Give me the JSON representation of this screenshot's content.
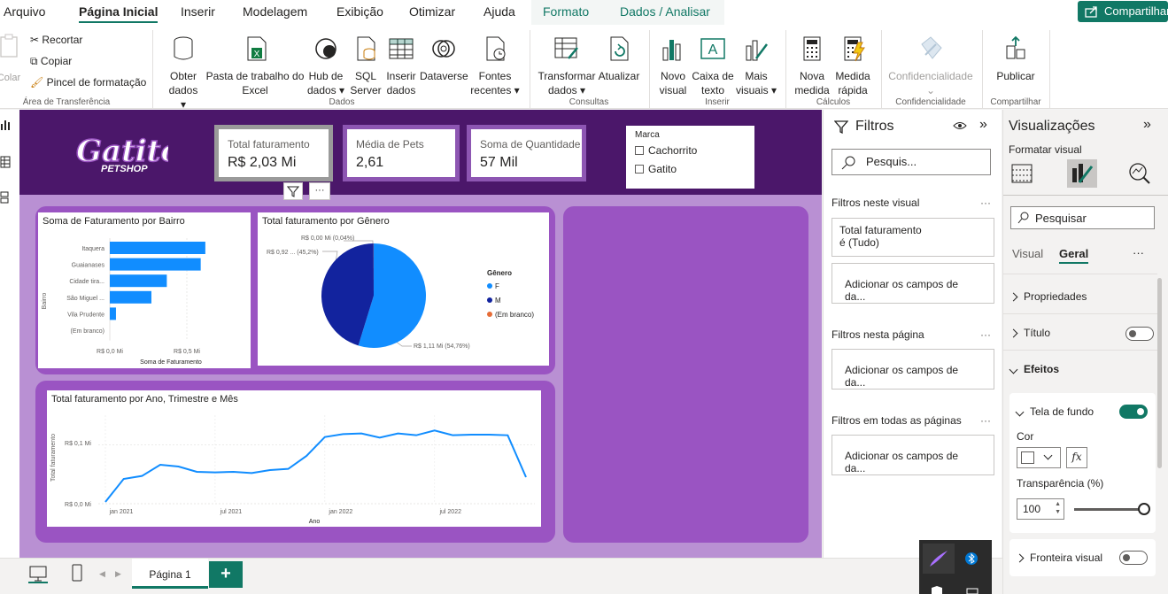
{
  "menubar": {
    "items": [
      "Arquivo",
      "Página Inicial",
      "Inserir",
      "Modelagem",
      "Exibição",
      "Otimizar",
      "Ajuda",
      "Formato",
      "Dados / Analisar"
    ],
    "active": "Página Inicial",
    "share_label": "Compartilhar"
  },
  "ribbon": {
    "clipboard": {
      "paste_label": "Colar",
      "cut": "Recortar",
      "copy": "Copiar",
      "format_painter": "Pincel de formatação",
      "group": "Área de Transferência"
    },
    "data": {
      "buttons": [
        {
          "line1": "Obter",
          "line2": "dados ▾"
        },
        {
          "line1": "Pasta de trabalho do",
          "line2": "Excel"
        },
        {
          "line1": "Hub de",
          "line2": "dados ▾"
        },
        {
          "line1": "SQL",
          "line2": "Server"
        },
        {
          "line1": "Inserir",
          "line2": "dados"
        },
        {
          "line1": "Dataverse",
          "line2": ""
        },
        {
          "line1": "Fontes",
          "line2": "recentes ▾"
        }
      ],
      "group": "Dados"
    },
    "queries": {
      "transform_1": "Transformar",
      "transform_2": "dados ▾",
      "refresh": "Atualizar",
      "group": "Consultas"
    },
    "insert": {
      "new_visual_1": "Novo",
      "new_visual_2": "visual",
      "textbox_1": "Caixa de",
      "textbox_2": "texto",
      "more_1": "Mais",
      "more_2": "visuais ▾",
      "group": "Inserir"
    },
    "calc": {
      "new_measure_1": "Nova",
      "new_measure_2": "medida",
      "quick_measure_1": "Medida",
      "quick_measure_2": "rápida",
      "group": "Cálculos"
    },
    "sensitivity": {
      "label": "Confidencialidade",
      "group": "Confidencialidade"
    },
    "share": {
      "publish": "Publicar",
      "group": "Compartilhar"
    }
  },
  "report": {
    "logo_main": "Gatito",
    "logo_sub": "PETSHOP",
    "cards": [
      {
        "label": "Total faturamento",
        "value": "R$ 2,03 Mi"
      },
      {
        "label": "Média de Pets",
        "value": "2,61"
      },
      {
        "label": "Soma de Quantidade",
        "value": "57 Mil"
      }
    ],
    "slicer": {
      "title": "Marca",
      "options": [
        "Cachorrito",
        "Gatito"
      ]
    },
    "bairro_chart": {
      "title": "Soma de Faturamento por Bairro",
      "ylabel": "Bairro",
      "xlabel": "Soma de Faturamento",
      "xticks": [
        "R$ 0,0 Mi",
        "R$ 0,5 Mi"
      ]
    },
    "genero_chart": {
      "title": "Total faturamento por Gênero",
      "legend_title": "Gênero",
      "labels": [
        "R$ 0,00 Mi (0,04%)",
        "R$ 0,92 ... (45,2%)",
        "R$ 1,11 Mi (54,76%)"
      ]
    },
    "time_chart": {
      "title": "Total faturamento por Ano, Trimestre e Mês",
      "ylabel": "Total faturamento",
      "xlabel": "Ano",
      "yticks": [
        "R$ 0,1 Mi",
        "R$ 0,0 Mi"
      ],
      "xticks": [
        "jan 2021",
        "jul 2021",
        "jan 2022",
        "jul 2022"
      ]
    }
  },
  "chart_data": [
    {
      "type": "bar",
      "title": "Soma de Faturamento por Bairro",
      "categories": [
        "Itaquera",
        "Guaianases",
        "Cidade tira...",
        "São Miguel ...",
        "Vila Prudente",
        "(Em branco)"
      ],
      "values": [
        0.62,
        0.59,
        0.37,
        0.27,
        0.04,
        0.0
      ],
      "xlabel": "Soma de Faturamento",
      "ylabel": "Bairro",
      "xlim": [
        0,
        0.7
      ],
      "color": "#118dff"
    },
    {
      "type": "pie",
      "title": "Total faturamento por Gênero",
      "categories": [
        "F",
        "M",
        "(Em branco)"
      ],
      "values": [
        54.76,
        45.2,
        0.04
      ],
      "colors": [
        "#118dff",
        "#12239e",
        "#e66c37"
      ],
      "legend_title": "Gênero"
    },
    {
      "type": "line",
      "title": "Total faturamento por Ano, Trimestre e Mês",
      "x": [
        "jan 2021",
        "fev 2021",
        "mar 2021",
        "abr 2021",
        "mai 2021",
        "jun 2021",
        "jul 2021",
        "ago 2021",
        "set 2021",
        "out 2021",
        "nov 2021",
        "dez 2021",
        "jan 2022",
        "fev 2022",
        "mar 2022",
        "abr 2022",
        "mai 2022",
        "jun 2022",
        "jul 2022",
        "ago 2022",
        "set 2022",
        "out 2022",
        "nov 2022",
        "dez 2022"
      ],
      "values": [
        0.003,
        0.042,
        0.047,
        0.066,
        0.063,
        0.054,
        0.053,
        0.054,
        0.052,
        0.057,
        0.059,
        0.081,
        0.113,
        0.118,
        0.119,
        0.112,
        0.119,
        0.116,
        0.124,
        0.116,
        0.117,
        0.117,
        0.116,
        0.045
      ],
      "ylim": [
        0,
        0.15
      ],
      "xlabel": "Ano",
      "ylabel": "Total faturamento",
      "color": "#118dff"
    }
  ],
  "filters": {
    "title": "Filtros",
    "search_placeholder": "Pesquis...",
    "this_visual": "Filtros neste visual",
    "filter_card_1": "Total faturamento",
    "filter_card_2": "é (Tudo)",
    "add_fields": "Adicionar os campos de da...",
    "this_page": "Filtros nesta página",
    "all_pages": "Filtros em todas as páginas",
    "more": "···"
  },
  "visualizations": {
    "title": "Visualizações",
    "format_label": "Formatar visual",
    "search_placeholder": "Pesquisar",
    "tab_visual": "Visual",
    "tab_general": "Geral",
    "more": "···",
    "properties": "Propriedades",
    "title_section": "Título",
    "effects": "Efeitos",
    "background": "Tela de fundo",
    "color_label": "Cor",
    "fx": "fx",
    "transparency_label": "Transparência (%)",
    "transparency_value": "100",
    "border": "Fronteira visual"
  },
  "bottom": {
    "page_tab": "Página 1",
    "add_page": "+"
  }
}
